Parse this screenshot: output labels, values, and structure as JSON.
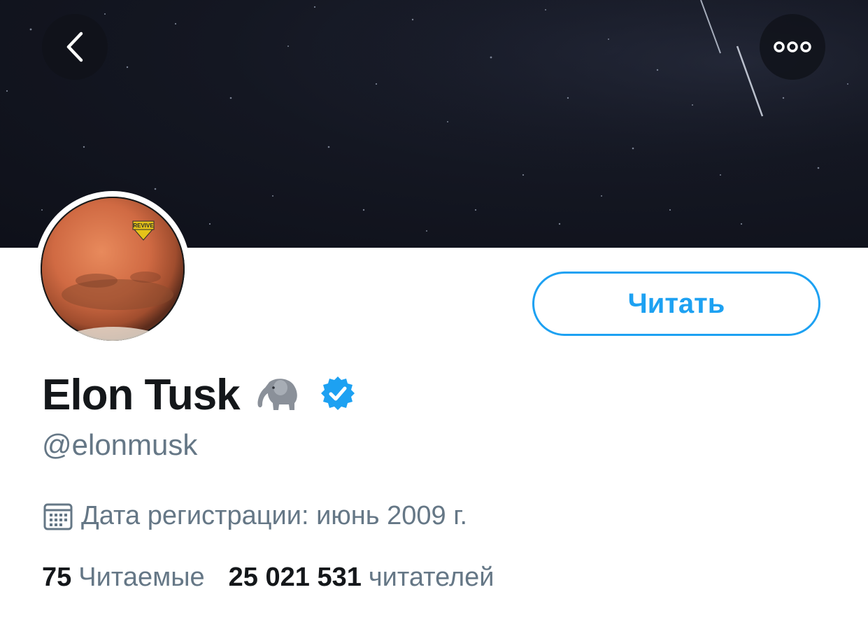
{
  "header": {
    "back_icon": "chevron-left-icon",
    "more_icon": "more-dots-icon"
  },
  "avatar": {
    "badge_text": "REVIVE"
  },
  "profile": {
    "follow_label": "Читать",
    "display_name": "Elon Tusk",
    "name_emoji": "🐘",
    "handle": "@elonmusk",
    "joined": "Дата регистрации: июнь 2009 г.",
    "following_count": "75",
    "following_label": "Читаемые",
    "followers_count": "25 021 531",
    "followers_label": "читателей"
  },
  "colors": {
    "accent": "#1da1f2",
    "text_primary": "#14171a",
    "text_secondary": "#657786",
    "banner": "#141722"
  }
}
